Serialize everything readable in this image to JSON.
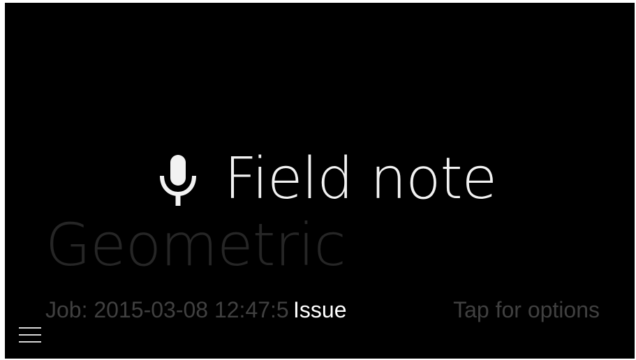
{
  "card": {
    "background_title": "Geometric",
    "overlay_title": "Field note",
    "overlay_icon": "microphone-icon",
    "footer": {
      "left": "Job: 2015-03-08 12:47:5",
      "center": "Issue",
      "right": "Tap for options"
    },
    "menu_icon": "menu-icon"
  },
  "colors": {
    "background": "#000000",
    "overlay_text": "#f2f2f2",
    "dim_text": "#404040",
    "ghost_text": "#262626"
  }
}
